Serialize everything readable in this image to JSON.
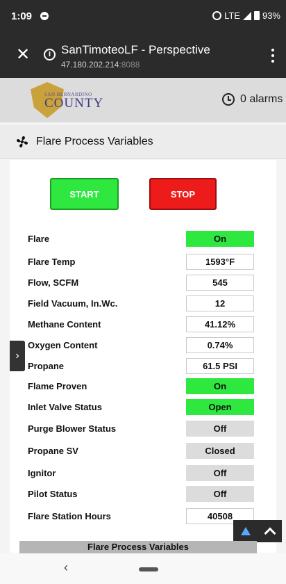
{
  "status_bar": {
    "time": "1:09",
    "network": "LTE",
    "battery": "93%"
  },
  "browser": {
    "title": "SanTimoteoLF - Perspective",
    "url_host": "47.180.202.214",
    "url_port": ":8088",
    "close_glyph": "✕"
  },
  "header": {
    "logo_top": "SAN BERNARDINO",
    "logo_main": "COUNTY",
    "alarms": "0 alarms"
  },
  "section": {
    "title": "Flare Process Variables"
  },
  "controls": {
    "start": "START",
    "stop": "STOP"
  },
  "variables": [
    {
      "label": "Flare",
      "value": "On"
    },
    {
      "label": "Flare Temp",
      "value": "1593°F"
    },
    {
      "label": "Flow, SCFM",
      "value": "545"
    },
    {
      "label": "Field Vacuum, In.Wc.",
      "value": "12"
    },
    {
      "label": "Methane Content",
      "value": "41.12%"
    },
    {
      "label": "Oxygen Content",
      "value": "0.74%"
    },
    {
      "label": "Propane",
      "value": "61.5 PSI"
    },
    {
      "label": "Flame Proven",
      "value": "On"
    },
    {
      "label": "Inlet Valve Status",
      "value": "Open"
    },
    {
      "label": "Purge Blower Status",
      "value": "Off"
    },
    {
      "label": "Propane SV",
      "value": "Closed"
    },
    {
      "label": "Ignitor",
      "value": "Off"
    },
    {
      "label": "Pilot Status",
      "value": "Off"
    },
    {
      "label": "Flare Station Hours",
      "value": "40508"
    }
  ],
  "colors": {
    "status_on": "#2ee840",
    "status_off": "#dcdcdc",
    "start": "#2ee840",
    "stop": "#ee1b1b"
  },
  "footer": {
    "tab_label": "Flare Process Variables"
  },
  "nav": {
    "back_glyph": "‹"
  },
  "icons": {
    "side_toggle_glyph": "›"
  }
}
